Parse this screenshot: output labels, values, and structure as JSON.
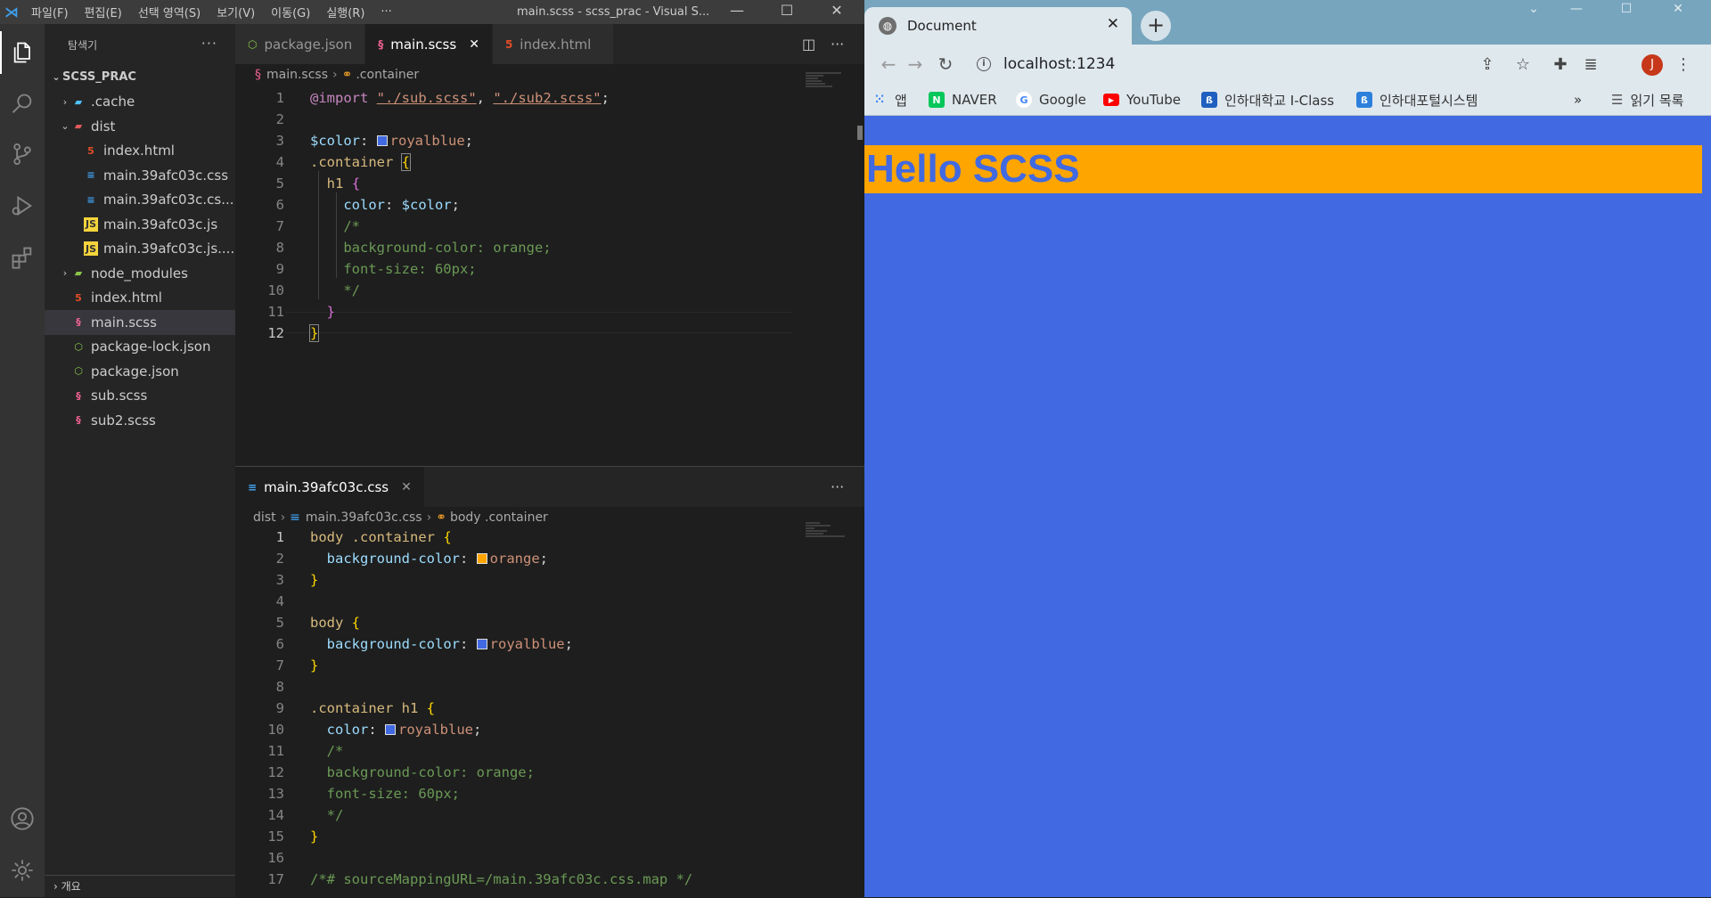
{
  "vscode": {
    "menu": [
      "파일(F)",
      "편집(E)",
      "선택 영역(S)",
      "보기(V)",
      "이동(G)",
      "실행(R)",
      "···"
    ],
    "window_title": "main.scss - scss_prac - Visual S...",
    "explorer_title": "탐색기",
    "explorer_more": "···",
    "root": "SCSS_PRAC",
    "tree": [
      {
        "label": ".cache",
        "kind": "folder-closed"
      },
      {
        "label": "dist",
        "kind": "folder-open"
      },
      {
        "label": "index.html",
        "kind": "html"
      },
      {
        "label": "main.39afc03c.css",
        "kind": "css"
      },
      {
        "label": "main.39afc03c.cs...",
        "kind": "css"
      },
      {
        "label": "main.39afc03c.js",
        "kind": "js"
      },
      {
        "label": "main.39afc03c.js....",
        "kind": "js"
      },
      {
        "label": "node_modules",
        "kind": "folder-closed"
      },
      {
        "label": "index.html",
        "kind": "html"
      },
      {
        "label": "main.scss",
        "kind": "scss"
      },
      {
        "label": "package-lock.json",
        "kind": "json"
      },
      {
        "label": "package.json",
        "kind": "json"
      },
      {
        "label": "sub.scss",
        "kind": "scss"
      },
      {
        "label": "sub2.scss",
        "kind": "scss"
      }
    ],
    "outline_label": "개요",
    "top_editor": {
      "tabs": [
        {
          "label": "package.json",
          "active": false
        },
        {
          "label": "main.scss",
          "active": true
        },
        {
          "label": "index.html",
          "active": false
        }
      ],
      "breadcrumb": [
        "main.scss",
        ".container"
      ],
      "line_numbers": [
        "1",
        "2",
        "3",
        "4",
        "5",
        "6",
        "7",
        "8",
        "9",
        "10",
        "11",
        "12"
      ]
    },
    "bottom_editor": {
      "tab": "main.39afc03c.css",
      "breadcrumb": [
        "dist",
        "main.39afc03c.css",
        "body .container"
      ],
      "line_numbers": [
        "1",
        "2",
        "3",
        "4",
        "5",
        "6",
        "7",
        "8",
        "9",
        "10",
        "11",
        "12",
        "13",
        "14",
        "15",
        "16",
        "17"
      ]
    },
    "scss_code": {
      "l1_at": "@import",
      "l1_s1": "\"./sub.scss\"",
      "l1_s2": "\"./sub2.scss\"",
      "l3_var": "$color",
      "l3_val": "royalblue",
      "l4_sel": ".container",
      "l5_sel": "h1",
      "l6_prop": "color",
      "l6_val": "$color",
      "l7": "/*",
      "l8": "background-color: orange;",
      "l9": "font-size: 60px;",
      "l10": "*/"
    },
    "css_code": {
      "l1_sel": "body .container",
      "l2_prop": "background-color",
      "l2_val": "orange",
      "l5_sel": "body",
      "l6_prop": "background-color",
      "l6_val": "royalblue",
      "l9_sel": ".container h1",
      "l10_prop": "color",
      "l10_val": "royalblue",
      "l11": "/*",
      "l12": "background-color: orange;",
      "l13": "font-size: 60px;",
      "l14": "*/",
      "l17": "/*# sourceMappingURL=/main.39afc03c.css.map */"
    },
    "colors": {
      "royalblue": "#4169e1",
      "orange": "#ffa500",
      "accent": "#007acc"
    }
  },
  "browser": {
    "tab_title": "Document",
    "url": "localhost:1234",
    "avatar_letter": "J",
    "bookmarks": [
      {
        "label": "앱",
        "icon": "apps-grid-icon",
        "color": "#4285f4"
      },
      {
        "label": "NAVER",
        "icon": "naver-icon",
        "color": "#03c75a"
      },
      {
        "label": "Google",
        "icon": "google-icon",
        "color": "#4285f4"
      },
      {
        "label": "YouTube",
        "icon": "youtube-icon",
        "color": "#ff0000"
      },
      {
        "label": "인하대학교 I-Class",
        "icon": "iclass-icon",
        "color": "#1f5fbf"
      },
      {
        "label": "인하대포털시스템",
        "icon": "portal-icon",
        "color": "#2d7fdc"
      }
    ],
    "bookmarks_more": "»",
    "reading_list": "읽기 목록",
    "page": {
      "heading": "Hello SCSS",
      "bg": "#4169e1",
      "heading_bg": "#ffa500"
    }
  }
}
